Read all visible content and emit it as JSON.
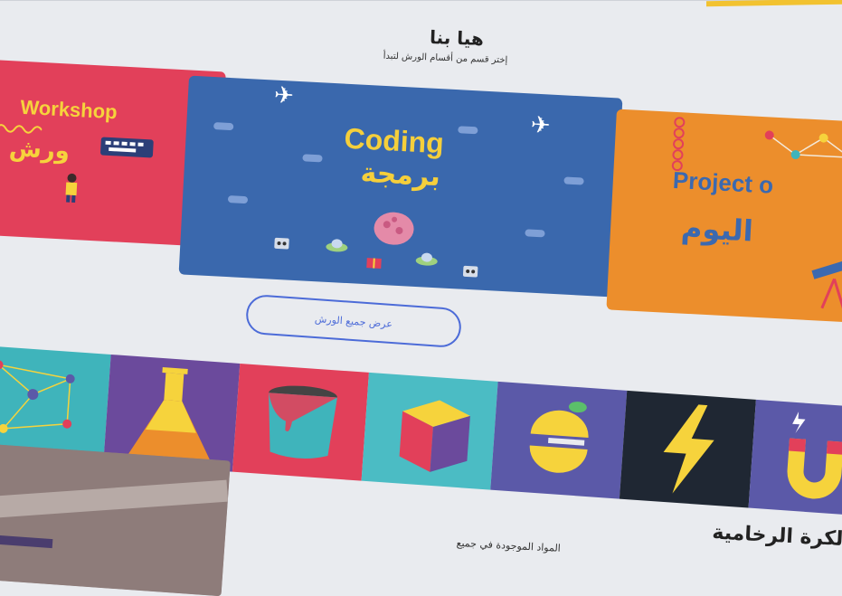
{
  "header": {
    "title": "هيا بنا",
    "subtitle": "إختر قسم من أقسام الورش لتبدأ"
  },
  "cards": [
    {
      "name": "workshop",
      "title_en": "Workshop",
      "title_ar": "ورش سَ",
      "color": "#e2405a"
    },
    {
      "name": "coding",
      "title_en": "Coding",
      "title_ar": "برمجة",
      "color": "#3a68ad"
    },
    {
      "name": "project",
      "title_en": "Project o",
      "title_ar": "اليوم",
      "color": "#ec8e2c"
    }
  ],
  "show_all_button": "عرض جميع الورش",
  "strip_colors": [
    "#3fb4bb",
    "#6b4a9c",
    "#e2405a",
    "#4bbcc4",
    "#5b59a8",
    "#1f2733",
    "#5b59a8"
  ],
  "strip_icons": [
    "network-icon",
    "flask-icon",
    "paint-bucket-icon",
    "cube-icon",
    "fruit-icon",
    "lightning-icon",
    "magnet-icon"
  ],
  "featured": {
    "title": "الكرة الرخامية",
    "subtitle": "المواد الموجودة في جميع"
  }
}
